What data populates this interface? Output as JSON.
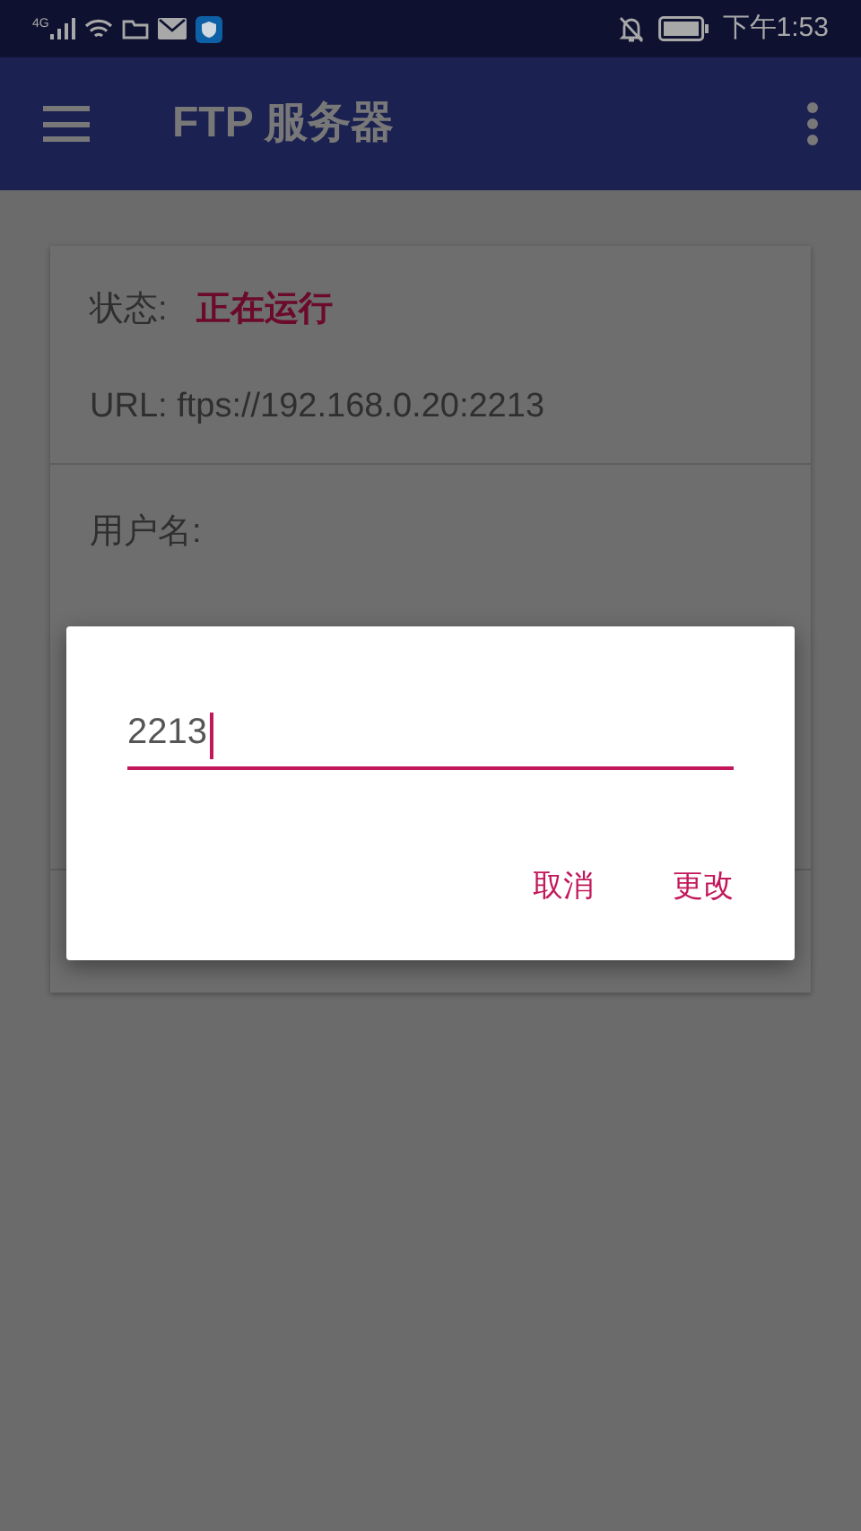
{
  "status_bar": {
    "network": "4G",
    "time": "下午1:53"
  },
  "app_bar": {
    "title": "FTP 服务器"
  },
  "server_card": {
    "status_label": "状态:",
    "status_value": "正在运行",
    "url": "URL: ftps://192.168.0.20:2213",
    "username_label": "用户名:"
  },
  "dialog": {
    "value": "2213",
    "buttons": [
      "取消",
      "更改"
    ]
  }
}
